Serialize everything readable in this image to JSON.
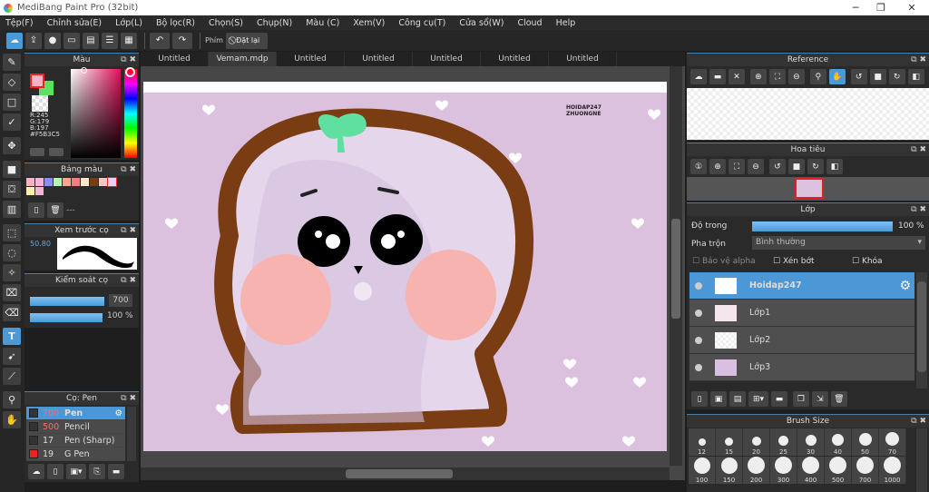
{
  "app": {
    "title": "MediBang Paint Pro (32bit)",
    "win_min": "─",
    "win_max": "❐",
    "win_close": "✕"
  },
  "menu": [
    "Tệp(F)",
    "Chỉnh sửa(E)",
    "Lớp(L)",
    "Bộ lọc(R)",
    "Chọn(S)",
    "Chụp(N)",
    "Màu (C)",
    "Xem(V)",
    "Công cụ(T)",
    "Cửa sổ(W)",
    "Cloud",
    "Help"
  ],
  "toolbar": {
    "key_label": "Phím",
    "reset_label": "Đặt lại"
  },
  "tabs": [
    "Untitled",
    "Vemam.mdp",
    "Untitled",
    "Untitled",
    "Untitled",
    "Untitled",
    "Untitled"
  ],
  "active_tab": 1,
  "canvas": {
    "watermark_line1": "HOIDAP247",
    "watermark_line2": "ZHUONGNE",
    "background": "#dcc1de"
  },
  "color_panel": {
    "title": "Màu",
    "r": "R:245",
    "g": "G:179",
    "b": "B:197",
    "hex": "#F5B3C5",
    "primary": "#f5b3c5",
    "secondary": "#5ee05e"
  },
  "palette_panel": {
    "title": "Bảng màu",
    "swatches": [
      "#f5b3c5",
      "#f5b3d5",
      "#8c8cf5",
      "#b3f5b3",
      "#f5a98c",
      "#f57f7f",
      "#fbe7c8",
      "#7a3c12",
      "#f9c9c0",
      "#e8d2f0",
      "#fdf0a8",
      "#f5b3d5"
    ],
    "name": "---"
  },
  "preview_panel": {
    "title": "Xem trước cọ",
    "size": "50.80"
  },
  "brush_control": {
    "title": "Kiểm soát cọ",
    "size": "700",
    "opacity": "100 %",
    "opacity_value": 100
  },
  "brush_panel": {
    "title": "Cọ: Pen",
    "items": [
      {
        "size": "700",
        "name": "Pen",
        "color": "#333"
      },
      {
        "size": "500",
        "name": "Pencil",
        "color": "#333"
      },
      {
        "size": "17",
        "name": "Pen (Sharp)",
        "color": "#333"
      },
      {
        "size": "19",
        "name": "G Pen",
        "color": "#e22"
      }
    ]
  },
  "reference_panel": {
    "title": "Reference"
  },
  "navigator_panel": {
    "title": "Hoa tiêu"
  },
  "layer_panel": {
    "title": "Lớp",
    "opacity_label": "Độ trong",
    "opacity": "100 %",
    "opacity_value": 100,
    "blend_label": "Pha trộn",
    "blend": "Bình thường",
    "protect_alpha": "Bảo vệ alpha",
    "clipping": "Xén bớt",
    "lock": "Khóa",
    "layers": [
      {
        "name": "Hoidap247",
        "selected": true
      },
      {
        "name": "Lớp1"
      },
      {
        "name": "Lớp2"
      },
      {
        "name": "Lớp3"
      }
    ]
  },
  "brush_size_panel": {
    "title": "Brush Size",
    "row1": [
      "12",
      "15",
      "20",
      "25",
      "30",
      "40",
      "50",
      "70"
    ],
    "row2": [
      "100",
      "150",
      "200",
      "300",
      "400",
      "500",
      "700",
      "1000"
    ]
  }
}
